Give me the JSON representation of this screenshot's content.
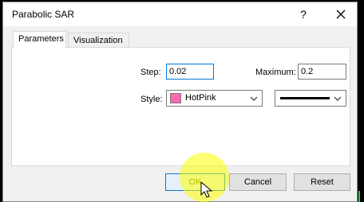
{
  "window": {
    "title": "Parabolic SAR",
    "help_label": "?",
    "close_icon": "close-icon"
  },
  "tabs": [
    {
      "label": "Parameters",
      "active": true
    },
    {
      "label": "Visualization",
      "active": false
    }
  ],
  "form": {
    "step_label": "Step:",
    "step_value": "0.02",
    "maximum_label": "Maximum:",
    "maximum_value": "0.2",
    "style_label": "Style:",
    "color_value": "HotPink",
    "color_swatch": "#ff69b4",
    "line_style_icon": "solid-line-icon"
  },
  "buttons": {
    "ok": "OK",
    "cancel": "Cancel",
    "reset": "Reset"
  },
  "colors": {
    "accent": "#0078d7",
    "highlight": "#ffff00"
  }
}
